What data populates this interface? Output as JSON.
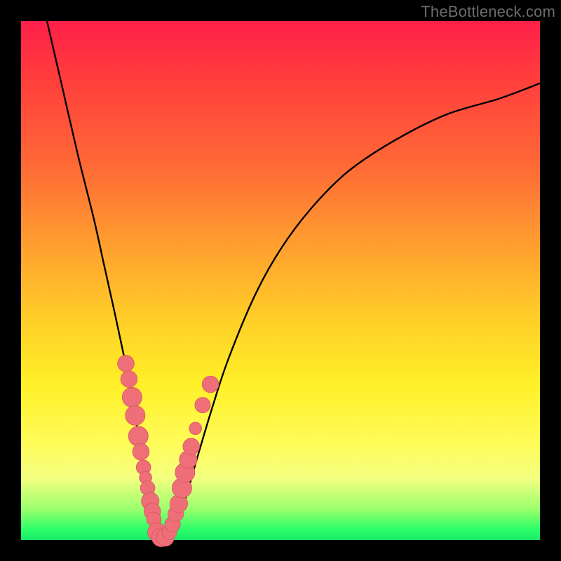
{
  "watermark": "TheBottleneck.com",
  "colors": {
    "frame": "#000000",
    "gradient_top": "#ff1f4a",
    "gradient_bottom": "#19e869",
    "curve": "#000000",
    "marker_fill": "#ef6f78",
    "marker_stroke": "#d9555f"
  },
  "chart_data": {
    "type": "line",
    "title": "",
    "xlabel": "",
    "ylabel": "",
    "xlim": [
      0,
      100
    ],
    "ylim": [
      0,
      100
    ],
    "series": [
      {
        "name": "curve",
        "x": [
          5,
          8,
          11,
          14,
          16,
          18,
          19.5,
          21,
          22,
          23,
          24,
          25,
          25.8,
          27,
          28.5,
          30,
          32,
          34,
          37,
          40,
          45,
          50,
          56,
          63,
          72,
          82,
          92,
          100
        ],
        "y": [
          100,
          87,
          74,
          62,
          53,
          44,
          37,
          30,
          24,
          18,
          12,
          7,
          3,
          0.5,
          0.5,
          3,
          9,
          16,
          26,
          35,
          47,
          56,
          64,
          71,
          77,
          82,
          85,
          88
        ]
      }
    ],
    "markers": [
      {
        "x": 20.2,
        "y": 34,
        "r": 1.6
      },
      {
        "x": 20.8,
        "y": 31,
        "r": 1.6
      },
      {
        "x": 21.4,
        "y": 27.5,
        "r": 1.9
      },
      {
        "x": 22.0,
        "y": 24,
        "r": 1.9
      },
      {
        "x": 22.6,
        "y": 20,
        "r": 1.9
      },
      {
        "x": 23.1,
        "y": 17,
        "r": 1.6
      },
      {
        "x": 23.6,
        "y": 14,
        "r": 1.4
      },
      {
        "x": 24.0,
        "y": 12,
        "r": 1.2
      },
      {
        "x": 24.4,
        "y": 10,
        "r": 1.4
      },
      {
        "x": 24.9,
        "y": 7.5,
        "r": 1.7
      },
      {
        "x": 25.3,
        "y": 5.5,
        "r": 1.6
      },
      {
        "x": 25.6,
        "y": 4,
        "r": 1.4
      },
      {
        "x": 26.2,
        "y": 1.5,
        "r": 1.8
      },
      {
        "x": 27.0,
        "y": 0.5,
        "r": 1.8
      },
      {
        "x": 27.8,
        "y": 0.5,
        "r": 1.7
      },
      {
        "x": 28.6,
        "y": 1.5,
        "r": 1.4
      },
      {
        "x": 29.2,
        "y": 3,
        "r": 1.5
      },
      {
        "x": 29.8,
        "y": 5,
        "r": 1.5
      },
      {
        "x": 30.4,
        "y": 7,
        "r": 1.7
      },
      {
        "x": 31.0,
        "y": 10,
        "r": 1.9
      },
      {
        "x": 31.6,
        "y": 13,
        "r": 1.9
      },
      {
        "x": 32.2,
        "y": 15.5,
        "r": 1.7
      },
      {
        "x": 32.8,
        "y": 18,
        "r": 1.6
      },
      {
        "x": 33.6,
        "y": 21.5,
        "r": 1.2
      },
      {
        "x": 35.0,
        "y": 26,
        "r": 1.5
      },
      {
        "x": 36.5,
        "y": 30,
        "r": 1.6
      }
    ]
  }
}
